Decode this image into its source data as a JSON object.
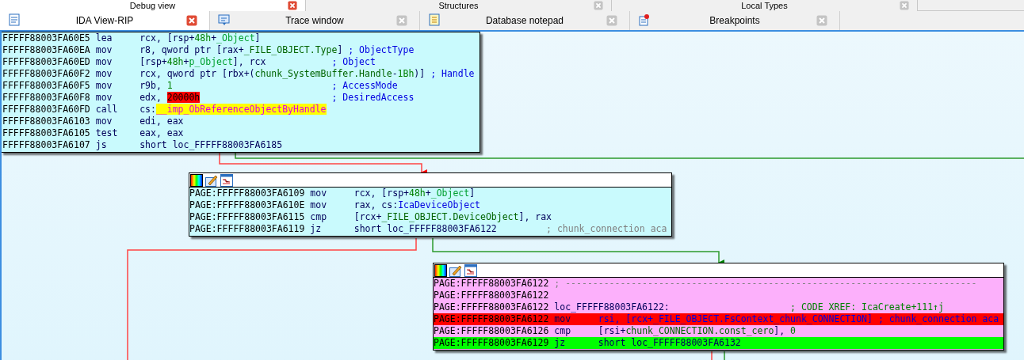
{
  "top_tabs": [
    {
      "label": "Debug view",
      "selected": true
    },
    {
      "label": "Structures",
      "selected": false
    },
    {
      "label": "Local Types",
      "selected": false
    }
  ],
  "tabs": [
    {
      "label": "IDA View-RIP",
      "selected": true
    },
    {
      "label": "Trace window",
      "selected": false
    },
    {
      "label": "Database notepad",
      "selected": false
    },
    {
      "label": "Breakpoints",
      "selected": false
    }
  ],
  "graph": {
    "blocks": [
      {
        "lines": [
          {
            "address": "FFFFF88003FA60E5",
            "mnemonic": "lea",
            "operands": [
              {
                "text": "rcx, [rsp+",
                "kind": "plain"
              },
              {
                "text": "48h",
                "kind": "num"
              },
              {
                "text": "+",
                "kind": "plain"
              },
              {
                "text": "_Object",
                "kind": "var"
              },
              {
                "text": "]",
                "kind": "plain"
              }
            ]
          },
          {
            "address": "FFFFF88003FA60EA",
            "mnemonic": "mov",
            "operands": [
              {
                "text": "r8, qword ptr [rax+",
                "kind": "plain"
              },
              {
                "text": "_FILE_OBJECT.Type",
                "kind": "struct"
              },
              {
                "text": "]",
                "kind": "plain"
              }
            ],
            "comment": {
              "text": "; ObjectType",
              "kind": "comment"
            }
          },
          {
            "address": "FFFFF88003FA60ED",
            "mnemonic": "mov",
            "operands": [
              {
                "text": "[rsp+",
                "kind": "plain"
              },
              {
                "text": "48h",
                "kind": "num"
              },
              {
                "text": "+",
                "kind": "plain"
              },
              {
                "text": "p_Object",
                "kind": "var"
              },
              {
                "text": "], rcx",
                "kind": "plain"
              }
            ],
            "comment": {
              "text": "; Object",
              "kind": "comment"
            }
          },
          {
            "address": "FFFFF88003FA60F2",
            "mnemonic": "mov",
            "operands": [
              {
                "text": "rcx, qword ptr [rbx+(",
                "kind": "plain"
              },
              {
                "text": "chunk_SystemBuffer.Handle",
                "kind": "struct"
              },
              {
                "text": "-",
                "kind": "plain"
              },
              {
                "text": "1Bh",
                "kind": "num"
              },
              {
                "text": ")]",
                "kind": "plain"
              }
            ],
            "comment": {
              "text": "; Handle",
              "kind": "comment"
            }
          },
          {
            "address": "FFFFF88003FA60F5",
            "mnemonic": "mov",
            "operands": [
              {
                "text": "r9b, ",
                "kind": "plain"
              },
              {
                "text": "1",
                "kind": "num"
              }
            ],
            "comment": {
              "text": "; AccessMode",
              "kind": "comment"
            }
          },
          {
            "address": "FFFFF88003FA60F8",
            "mnemonic": "mov",
            "operands": [
              {
                "text": "edx, ",
                "kind": "plain"
              },
              {
                "text": "20000h",
                "kind": "hot"
              }
            ],
            "comment": {
              "text": "; DesiredAccess",
              "kind": "comment"
            }
          },
          {
            "address": "FFFFF88003FA60FD",
            "mnemonic": "call",
            "operands": [
              {
                "text": "cs:",
                "kind": "plain"
              },
              {
                "text": "__imp_ObReferenceObjectByHandle",
                "kind": "import"
              }
            ]
          },
          {
            "address": "FFFFF88003FA6103",
            "mnemonic": "mov",
            "operands": [
              {
                "text": "edi, eax",
                "kind": "plain"
              }
            ]
          },
          {
            "address": "FFFFF88003FA6105",
            "mnemonic": "test",
            "operands": [
              {
                "text": "eax, eax",
                "kind": "plain"
              }
            ]
          },
          {
            "address": "FFFFF88003FA6107",
            "mnemonic": "js",
            "operands": [
              {
                "text": "short loc_FFFFF88003FA6185",
                "kind": "plain"
              }
            ]
          }
        ]
      },
      {
        "lines": [
          {
            "address": "PAGE:FFFFF88003FA6109",
            "mnemonic": "mov",
            "operands": [
              {
                "text": "rcx, [rsp+",
                "kind": "plain"
              },
              {
                "text": "48h",
                "kind": "num"
              },
              {
                "text": "+",
                "kind": "plain"
              },
              {
                "text": "_Object",
                "kind": "var"
              },
              {
                "text": "]",
                "kind": "plain"
              }
            ]
          },
          {
            "address": "PAGE:FFFFF88003FA610E",
            "mnemonic": "mov",
            "operands": [
              {
                "text": "rax, cs:",
                "kind": "plain"
              },
              {
                "text": "IcaDeviceObject",
                "kind": "name"
              }
            ]
          },
          {
            "address": "PAGE:FFFFF88003FA6115",
            "mnemonic": "cmp",
            "operands": [
              {
                "text": "[rcx+",
                "kind": "plain"
              },
              {
                "text": "_FILE_OBJECT.DeviceObject",
                "kind": "struct"
              },
              {
                "text": "], rax",
                "kind": "plain"
              }
            ]
          },
          {
            "address": "PAGE:FFFFF88003FA6119",
            "mnemonic": "jz",
            "operands": [
              {
                "text": "short loc_FFFFF88003FA6122",
                "kind": "plain"
              }
            ],
            "comment": {
              "text": "; chunk_connection aca",
              "kind": "auto"
            }
          }
        ]
      },
      {
        "lines": [
          {
            "kind": "plain",
            "address": "PAGE:FFFFF88003FA6122",
            "comment": {
              "text": "; ---------------------------------------------------------------------------",
              "kind": "auto"
            }
          },
          {
            "kind": "plain",
            "address": "PAGE:FFFFF88003FA6122"
          },
          {
            "kind": "plain",
            "address": "PAGE:FFFFF88003FA6122",
            "label": "loc_FFFFF88003FA6122:",
            "comment": {
              "text": "; CODE XREF: IcaCreate+111↑j",
              "kind": "xref"
            }
          },
          {
            "kind": "breakpoint",
            "address": "PAGE:FFFFF88003FA6122",
            "mnemonic": "mov",
            "operands": [
              {
                "text": "rsi, [rcx+_FILE_OBJECT.FsContext_chunk_CONNECTION]",
                "kind": "name"
              }
            ],
            "comment": {
              "text": "; chunk_connection aca",
              "kind": "comment"
            }
          },
          {
            "kind": "plain",
            "address": "PAGE:FFFFF88003FA6126",
            "mnemonic": "cmp",
            "operands": [
              {
                "text": "[rsi+",
                "kind": "plain"
              },
              {
                "text": "chunk_CONNECTION.const_cero",
                "kind": "struct"
              },
              {
                "text": "], ",
                "kind": "plain"
              },
              {
                "text": "0",
                "kind": "num"
              }
            ]
          },
          {
            "kind": "current",
            "address": "PAGE:FFFFF88003FA6129",
            "mnemonic": "jz",
            "operands": [
              {
                "text": "short loc_FFFFF88003FA6132",
                "kind": "plain"
              }
            ]
          }
        ]
      }
    ]
  }
}
